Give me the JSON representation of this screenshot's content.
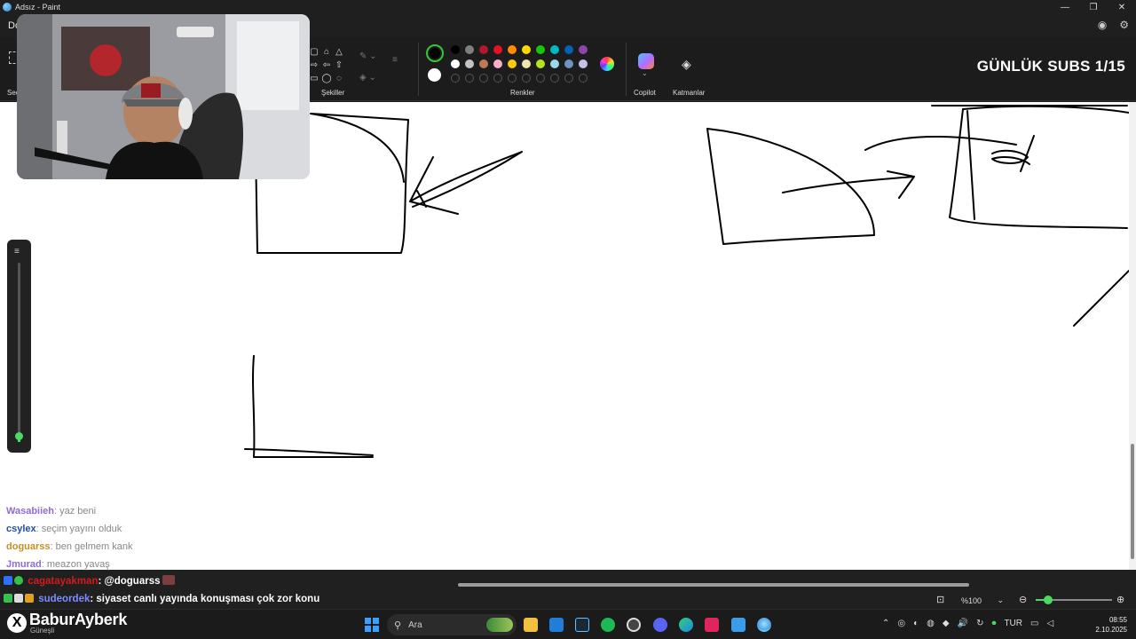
{
  "window": {
    "title": "Adsız - Paint",
    "minimize_icon": "minimize-icon",
    "maximize_icon": "restore-icon",
    "close_icon": "close-icon"
  },
  "menu": {
    "first_item_partial": "Do"
  },
  "ribbon": {
    "select_label_partial": "Seç",
    "shapes_label": "Şekiller",
    "colors_label": "Renkler",
    "copilot_label": "Copilot",
    "layers_label": "Katmanlar",
    "palette_row1": [
      "#000000",
      "#7f7f7f",
      "#b3172b",
      "#e81123",
      "#ff8c00",
      "#ffd800",
      "#16c60c",
      "#00b7c3",
      "#0063b1",
      "#8e44ad"
    ],
    "palette_row2": [
      "#ffffff",
      "#c3c3c3",
      "#b97a57",
      "#ffaec9",
      "#ffc90e",
      "#efe4b0",
      "#b5e61d",
      "#99d9ea",
      "#7092be",
      "#c8bfe7"
    ],
    "primary_color": "#000000",
    "secondary_color": "#ffffff"
  },
  "overlay": {
    "subs_counter": "GÜNLÜK SUBS 1/15"
  },
  "chat": {
    "messages": [
      {
        "user": "Wasabiieh",
        "text": ": yaz beni",
        "color": "#8e6bd6"
      },
      {
        "user": "csylex",
        "text": ": seçim yayını olduk",
        "color": "#1d4fb0"
      },
      {
        "user": "doguarss",
        "text": ": ben gelmem kank",
        "color": "#c8901e"
      },
      {
        "user": "Jmurad",
        "text": ": meazon yavaş",
        "color": "#8e6bd6"
      }
    ],
    "live_messages": [
      {
        "user": "cagatayakman",
        "text": ": @doguarss",
        "color": "#d11c1c"
      },
      {
        "user": "sudeordek",
        "text": ": siyaset canlı yayında konuşması çok zor konu",
        "color": "#7a8cff"
      }
    ]
  },
  "statusbar": {
    "zoom_value": "%100",
    "zoom_level": 0.16
  },
  "taskbar": {
    "brand": "BaburAyberk",
    "brand_x": "X",
    "weather": "Güneşli",
    "search_placeholder": "Ara",
    "language": "TUR",
    "time": "08:55",
    "date": "2.10.2025"
  }
}
